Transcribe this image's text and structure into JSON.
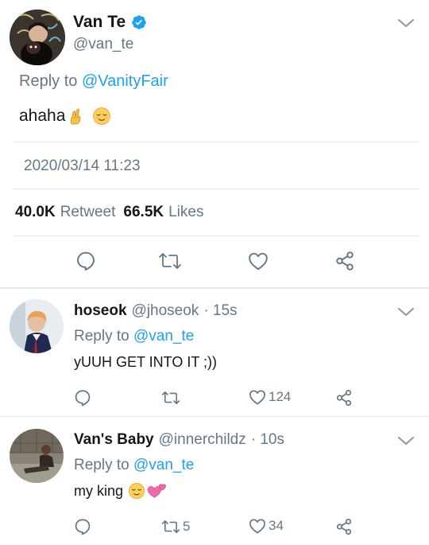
{
  "main_tweet": {
    "display_name": "Van Te",
    "handle": "@van_te",
    "reply_prefix": "Reply to ",
    "reply_to": "@VanityFair",
    "text": "ahaha",
    "emojis": [
      "crossed-fingers-emoji",
      "relieved-face-emoji"
    ],
    "timestamp": "2020/03/14 11:23",
    "retweet_count": "40.0K",
    "retweet_label": "Retweet",
    "like_count": "66.5K",
    "like_label": "Likes"
  },
  "replies": [
    {
      "display_name": "hoseok",
      "handle": "@jhoseok",
      "time": "· 15s",
      "reply_prefix": "Reply to ",
      "reply_to": "@van_te",
      "text": "yUUH GET INTO IT ;))",
      "retweets": "",
      "likes": "124"
    },
    {
      "display_name": "Van's Baby",
      "handle": "@innerchildz",
      "time": "· 10s",
      "reply_prefix": "Reply to ",
      "reply_to": "@van_te",
      "text": "my king",
      "emojis": [
        "relieved-face-emoji",
        "revolving-hearts-emoji"
      ],
      "retweets": "5",
      "likes": "34"
    }
  ],
  "colors": {
    "accent": "#1da1f2",
    "secondary_text": "#657786",
    "divider": "#e6ecf0",
    "icon": "#657786"
  }
}
